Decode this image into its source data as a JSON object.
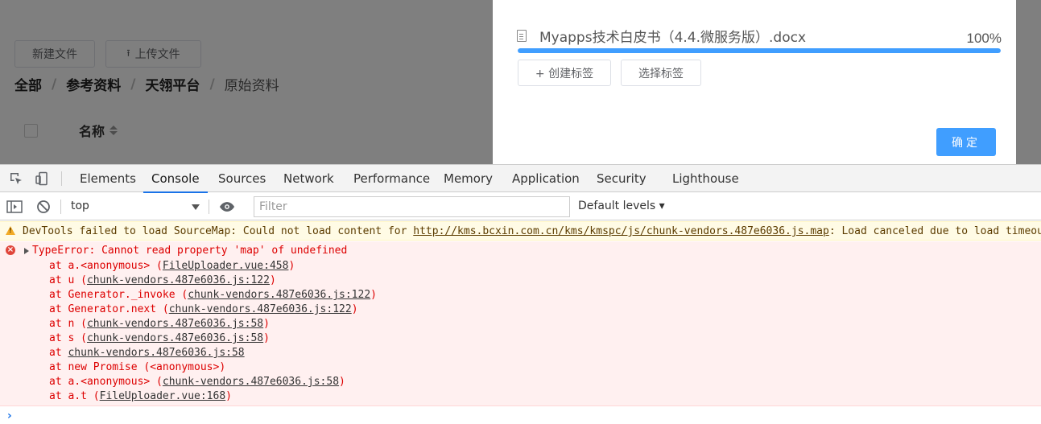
{
  "page": {
    "buttons": {
      "new_file": "新建文件",
      "upload_file": "上传文件",
      "upload_icon": "⭱"
    },
    "breadcrumb": [
      "全部",
      "参考资料",
      "天翎平台",
      "原始资料"
    ],
    "breadcrumb_sep": "/",
    "table": {
      "column_name": "名称"
    }
  },
  "dialog": {
    "file_name": "Myapps技术白皮书（4.4.微服务版）.docx",
    "progress_text": "100%",
    "progress_value": 1.0,
    "create_tag": "+ 创建标签",
    "select_tag": "选择标签",
    "confirm": "确定"
  },
  "devtools": {
    "tabs": [
      "Elements",
      "Console",
      "Sources",
      "Network",
      "Performance",
      "Memory",
      "Application",
      "Security",
      "Lighthouse"
    ],
    "active_tab": "Console",
    "context": "top",
    "filter_placeholder": "Filter",
    "levels": "Default levels ▾",
    "warning": {
      "prefix": "DevTools failed to load SourceMap: Could not load content for ",
      "url": "http://kms.bcxin.com.cn/kms/kmspc/js/chunk-vendors.487e6036.js.map",
      "suffix": ": Load canceled due to load timeout"
    },
    "error": {
      "header": "TypeError: Cannot read property 'map' of undefined",
      "frames": [
        {
          "pre": "at a.<anonymous> (",
          "loc": "FileUploader.vue:458",
          "post": ")"
        },
        {
          "pre": "at u (",
          "loc": "chunk-vendors.487e6036.js:122",
          "post": ")"
        },
        {
          "pre": "at Generator._invoke (",
          "loc": "chunk-vendors.487e6036.js:122",
          "post": ")"
        },
        {
          "pre": "at Generator.next (",
          "loc": "chunk-vendors.487e6036.js:122",
          "post": ")"
        },
        {
          "pre": "at n (",
          "loc": "chunk-vendors.487e6036.js:58",
          "post": ")"
        },
        {
          "pre": "at s (",
          "loc": "chunk-vendors.487e6036.js:58",
          "post": ")"
        },
        {
          "pre": "at ",
          "loc": "chunk-vendors.487e6036.js:58",
          "post": ""
        },
        {
          "pre": "at new Promise (<anonymous>)",
          "loc": "",
          "post": ""
        },
        {
          "pre": "at a.<anonymous> (",
          "loc": "chunk-vendors.487e6036.js:58",
          "post": ")"
        },
        {
          "pre": "at a.t (",
          "loc": "FileUploader.vue:168",
          "post": ")"
        }
      ]
    },
    "prompt": "›"
  },
  "colors": {
    "accent": "#409eff",
    "devtools_active": "#1a73e8",
    "error_bg": "#fff0f0",
    "warning_bg": "#fffbe5"
  }
}
